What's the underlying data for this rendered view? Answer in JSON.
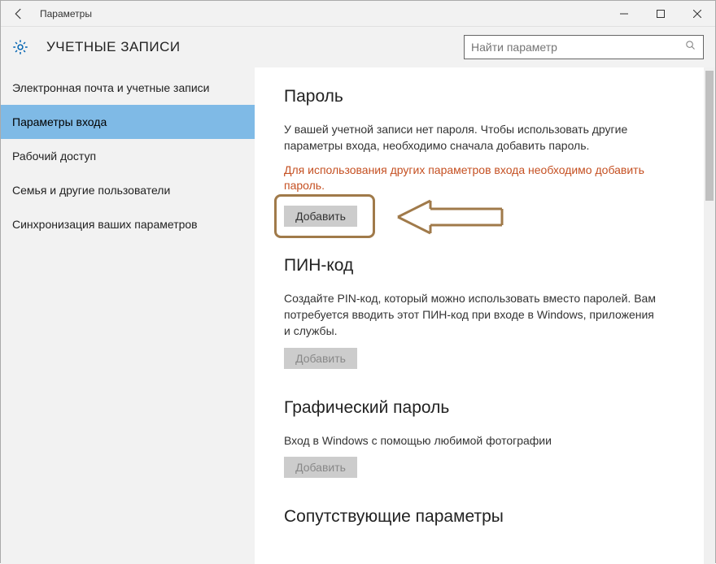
{
  "window": {
    "title": "Параметры"
  },
  "header": {
    "category": "УЧЕТНЫЕ ЗАПИСИ",
    "search_placeholder": "Найти параметр"
  },
  "sidebar": {
    "items": [
      {
        "label": "Электронная почта и учетные записи"
      },
      {
        "label": "Параметры входа"
      },
      {
        "label": "Рабочий доступ"
      },
      {
        "label": "Семья и другие пользователи"
      },
      {
        "label": "Синхронизация ваших параметров"
      }
    ],
    "selected_index": 1
  },
  "content": {
    "password": {
      "title": "Пароль",
      "desc": "У вашей учетной записи нет пароля. Чтобы использовать другие параметры входа, необходимо сначала добавить пароль.",
      "warn": "Для использования других параметров входа необходимо добавить пароль.",
      "button": "Добавить"
    },
    "pin": {
      "title": "ПИН-код",
      "desc": "Создайте PIN-код, который можно использовать вместо паролей. Вам потребуется вводить этот ПИН-код при входе в Windows, приложения и службы.",
      "button": "Добавить"
    },
    "picture": {
      "title": "Графический пароль",
      "desc": "Вход в Windows с помощью любимой фотографии",
      "button": "Добавить"
    },
    "related": {
      "title": "Сопутствующие параметры"
    }
  }
}
